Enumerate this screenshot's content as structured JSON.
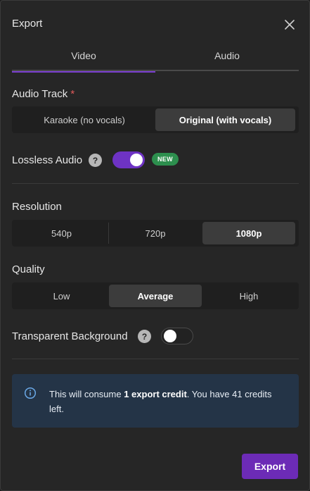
{
  "dialog": {
    "title": "Export",
    "close_icon": "close-icon",
    "tabs": [
      {
        "label": "Video",
        "active": true
      },
      {
        "label": "Audio",
        "active": false
      }
    ]
  },
  "audio_track": {
    "label": "Audio Track",
    "required_mark": "*",
    "options": [
      "Karaoke (no vocals)",
      "Original (with vocals)"
    ],
    "selected": "Original (with vocals)"
  },
  "lossless_audio": {
    "label": "Lossless Audio",
    "help": "?",
    "enabled": true,
    "badge": "NEW"
  },
  "resolution": {
    "label": "Resolution",
    "options": [
      "540p",
      "720p",
      "1080p"
    ],
    "selected": "1080p"
  },
  "quality": {
    "label": "Quality",
    "options": [
      "Low",
      "Average",
      "High"
    ],
    "selected": "Average"
  },
  "transparent_background": {
    "label": "Transparent Background",
    "help": "?",
    "enabled": false
  },
  "info": {
    "icon": "info-icon",
    "text_before": "This will consume ",
    "text_bold": "1 export credit",
    "text_after": ". You have 41 credits left."
  },
  "footer": {
    "export_label": "Export"
  },
  "colors": {
    "accent": "#6c2bb6",
    "badge": "#2d8f4e",
    "info_bg": "#243447",
    "required": "#e05a5a"
  }
}
